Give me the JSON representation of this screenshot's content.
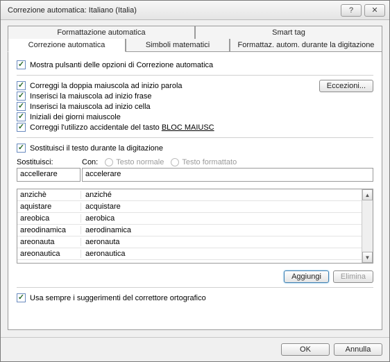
{
  "title": "Correzione automatica: Italiano (Italia)",
  "tabs_top": [
    "Formattazione automatica",
    "Smart tag"
  ],
  "tabs_bot": [
    "Correzione automatica",
    "Simboli matematici",
    "Formattaz. autom. durante la digitazione"
  ],
  "opt_show_buttons": "Mostra pulsanti delle opzioni di Correzione automatica",
  "opt_double_cap": "Correggi la doppia maiuscola ad inizio parola",
  "opt_cap_sentence": "Inserisci la maiuscola ad inizio frase",
  "opt_cap_cell": "Inserisci la maiuscola ad inizio cella",
  "opt_day_caps": "Iniziali dei giorni maiuscole",
  "opt_capslock_pre": "Correggi l'utilizzo accidentale del tasto ",
  "opt_capslock_key": "BLOC MAIUSC",
  "btn_exceptions": "Eccezioni...",
  "opt_replace": "Sostituisci il testo durante la digitazione",
  "lbl_replace": "Sostituisci:",
  "lbl_with": "Con:",
  "radio_plain": "Testo normale",
  "radio_formatted": "Testo formattato",
  "input_key": "accellerare",
  "input_val": "accelerare",
  "rows": [
    {
      "k": "anzichè",
      "v": "anziché"
    },
    {
      "k": "aquistare",
      "v": "acquistare"
    },
    {
      "k": "areobica",
      "v": "aerobica"
    },
    {
      "k": "areodinamica",
      "v": "aerodinamica"
    },
    {
      "k": "areonauta",
      "v": "aeronauta"
    },
    {
      "k": "areonautica",
      "v": "aeronautica"
    }
  ],
  "btn_add": "Aggiungi",
  "btn_delete": "Elimina",
  "opt_spell": "Usa sempre i suggerimenti del correttore ortografico",
  "btn_ok": "OK",
  "btn_cancel": "Annulla"
}
